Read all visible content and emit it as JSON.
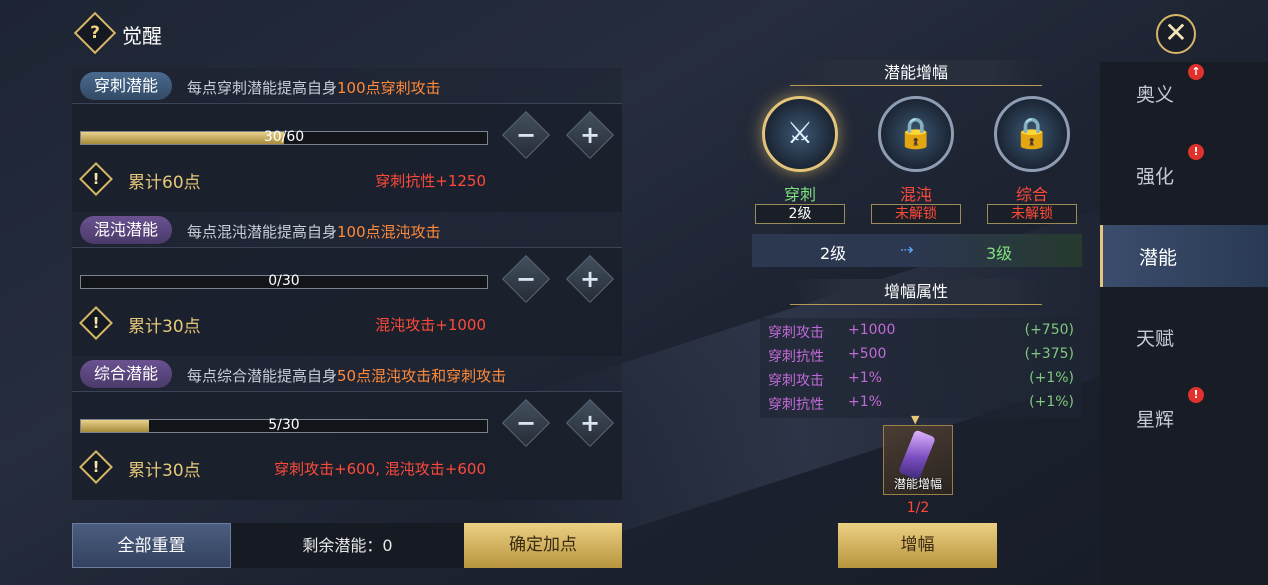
{
  "header": {
    "title": "觉醒",
    "help_icon": "?",
    "close_icon": "✕"
  },
  "potentials": [
    {
      "label": "穿刺潜能",
      "desc_prefix": "每点穿刺潜能提高自身",
      "desc_highlight": "100点穿刺攻击",
      "progress": "30/60",
      "progress_value": 30,
      "progress_max": 60,
      "accum": "累计60点",
      "bonus": "穿刺抗性+1250"
    },
    {
      "label": "混沌潜能",
      "desc_prefix": "每点混沌潜能提高自身",
      "desc_highlight": "100点混沌攻击",
      "progress": "0/30",
      "progress_value": 0,
      "progress_max": 30,
      "accum": "累计30点",
      "bonus": "混沌攻击+1000"
    },
    {
      "label": "综合潜能",
      "desc_prefix": "每点综合潜能提高自身",
      "desc_highlight": "50点混沌攻击和穿刺攻击",
      "progress": "5/30",
      "progress_value": 5,
      "progress_max": 30,
      "accum": "累计30点",
      "bonus": "穿刺攻击+600, 混沌攻击+600"
    }
  ],
  "buttons": {
    "minus": "−",
    "plus": "+",
    "reset": "全部重置",
    "remaining": "剩余潜能：0",
    "confirm": "确定加点",
    "amplify": "增幅"
  },
  "amplify_panel": {
    "title": "潜能增幅",
    "nodes": [
      {
        "name": "穿刺",
        "tag": "2级",
        "name_color": "#7ee07e",
        "tag_color": "#ffffff"
      },
      {
        "name": "混沌",
        "tag": "未解锁",
        "name_color": "#ff4a3a",
        "tag_color": "#ff4a3a"
      },
      {
        "name": "综合",
        "tag": "未解锁",
        "name_color": "#ff4a3a",
        "tag_color": "#ff4a3a"
      }
    ],
    "level_from": "2级",
    "level_to": "3级",
    "attr_title": "增幅属性",
    "attrs": [
      {
        "name": "穿刺攻击",
        "value": "+1000",
        "delta": "(+750)"
      },
      {
        "name": "穿刺抗性",
        "value": "+500",
        "delta": "(+375)"
      },
      {
        "name": "穿刺攻击",
        "value": "+1%",
        "delta": "(+1%)"
      },
      {
        "name": "穿刺抗性",
        "value": "+1%",
        "delta": "(+1%)"
      }
    ],
    "item_label": "潜能增幅",
    "item_count": "1/2"
  },
  "sidebar": {
    "items": [
      {
        "label": "奥义",
        "badge": "↑",
        "active": false
      },
      {
        "label": "强化",
        "badge": "!",
        "active": false
      },
      {
        "label": "潜能",
        "badge": "",
        "active": true
      },
      {
        "label": "天赋",
        "badge": "",
        "active": false
      },
      {
        "label": "星辉",
        "badge": "!",
        "active": false
      }
    ]
  },
  "colors": {
    "gold": "#e6c878",
    "red": "#ff4a3a",
    "green": "#7ee07e",
    "purple": "#c36ad8",
    "accent": "#5fa8ff"
  }
}
